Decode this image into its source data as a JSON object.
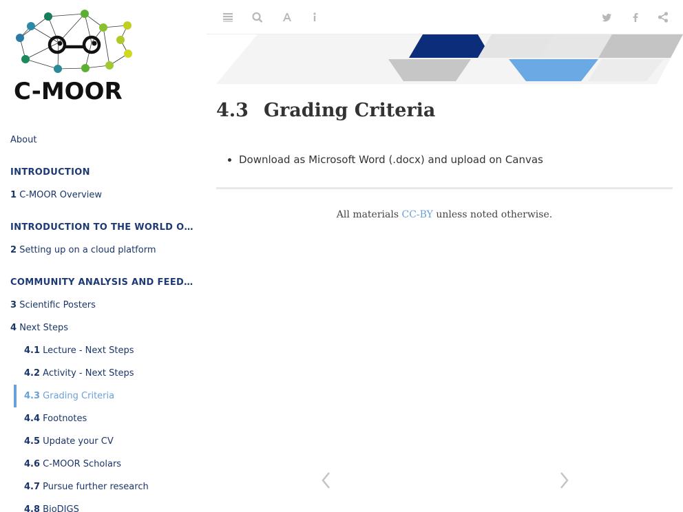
{
  "logo": {
    "text": "C-MOOR"
  },
  "sidebar": {
    "about": "About",
    "sections": [
      {
        "header": "INTRODUCTION",
        "chapters": [
          {
            "num": "1",
            "label": "C-MOOR Overview"
          }
        ]
      },
      {
        "header": "INTRODUCTION TO THE WORLD OF RESEARCH",
        "chapters": [
          {
            "num": "2",
            "label": "Setting up on a cloud platform"
          }
        ]
      },
      {
        "header": "COMMUNITY ANALYSIS AND FEEDBACK",
        "chapters": [
          {
            "num": "3",
            "label": "Scientific Posters"
          },
          {
            "num": "4",
            "label": "Next Steps"
          }
        ]
      }
    ],
    "subitems": [
      {
        "num": "4.1",
        "label": "Lecture - Next Steps"
      },
      {
        "num": "4.2",
        "label": "Activity - Next Steps"
      },
      {
        "num": "4.3",
        "label": "Grading Criteria"
      },
      {
        "num": "4.4",
        "label": "Footnotes"
      },
      {
        "num": "4.5",
        "label": "Update your CV"
      },
      {
        "num": "4.6",
        "label": "C-MOOR Scholars"
      },
      {
        "num": "4.7",
        "label": "Pursue further research"
      },
      {
        "num": "4.8",
        "label": "BioDIGS"
      }
    ],
    "active": "4.3"
  },
  "toolbar": {
    "icons": [
      "menu-icon",
      "search-icon",
      "font-icon",
      "info-icon",
      "twitter-icon",
      "facebook-icon",
      "share-icon"
    ]
  },
  "main": {
    "section_num": "4.3",
    "section_title": "Grading Criteria",
    "bullets": [
      "Download as Microsoft Word (.docx) and upload on Canvas"
    ],
    "footer_before": "All materials ",
    "footer_link": "CC-BY",
    "footer_after": " unless noted otherwise."
  },
  "colors": {
    "accent": "#6aa0d8",
    "nav_text": "#1a3569",
    "banner_navy": "#0b2d7a",
    "banner_light_blue": "#6aa9e3",
    "banner_gray": "#c4c4c4"
  }
}
